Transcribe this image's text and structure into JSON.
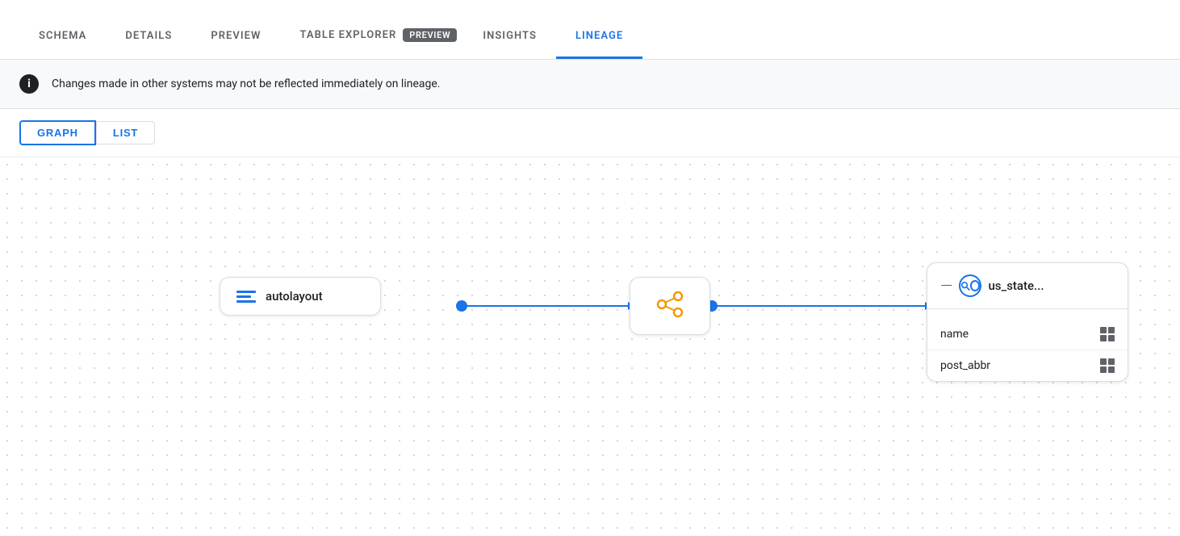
{
  "tabs": [
    {
      "id": "schema",
      "label": "SCHEMA",
      "active": false
    },
    {
      "id": "details",
      "label": "DETAILS",
      "active": false
    },
    {
      "id": "preview",
      "label": "PREVIEW",
      "active": false
    },
    {
      "id": "table-explorer",
      "label": "TABLE EXPLORER",
      "badge": "PREVIEW",
      "active": false
    },
    {
      "id": "insights",
      "label": "INSIGHTS",
      "active": false
    },
    {
      "id": "lineage",
      "label": "LINEAGE",
      "active": true
    }
  ],
  "info_banner": {
    "text": "Changes made in other systems may not be reflected immediately on lineage."
  },
  "toggle": {
    "graph_label": "GRAPH",
    "list_label": "LIST",
    "active": "graph"
  },
  "graph": {
    "nodes": [
      {
        "id": "autolayout",
        "label": "autolayout",
        "type": "table"
      },
      {
        "id": "transform",
        "label": "",
        "type": "transform"
      },
      {
        "id": "usstates",
        "label": "us_state...",
        "type": "output",
        "fields": [
          {
            "name": "name"
          },
          {
            "name": "post_abbr"
          }
        ]
      }
    ]
  },
  "colors": {
    "active_tab": "#1a73e8",
    "orange": "#f29900",
    "blue": "#1a73e8",
    "text_dark": "#202124",
    "text_medium": "#5f6368",
    "border": "#dadce0",
    "bg_info": "#f8f9fa"
  }
}
